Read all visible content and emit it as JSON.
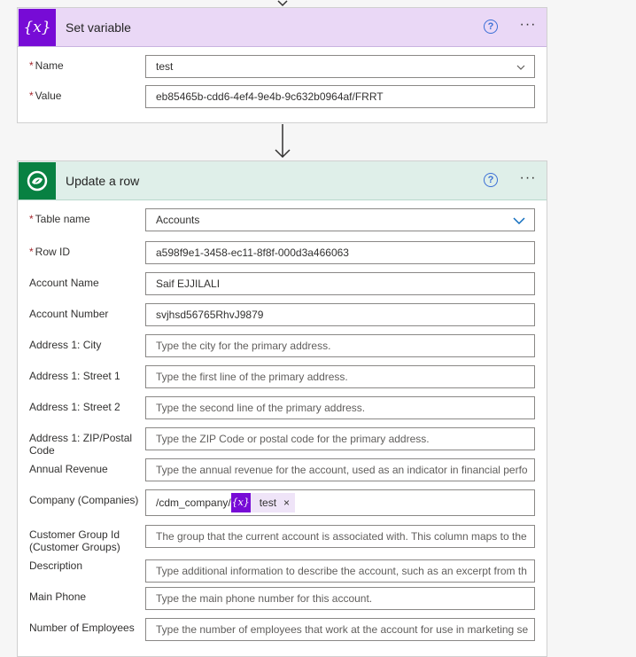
{
  "set_variable": {
    "title": "Set variable",
    "icon": "variable-icon",
    "icon_text": "{x}",
    "name_label": "Name",
    "name_value": "test",
    "value_label": "Value",
    "value_value": "eb85465b-cdd6-4ef4-9e4b-9c632b0964af/FRRT"
  },
  "update_row": {
    "title": "Update a row",
    "icon": "dataverse-icon",
    "fields": [
      {
        "label": "Table name",
        "required": true,
        "value": "Accounts",
        "placeholder": false
      },
      {
        "label": "Row ID",
        "required": true,
        "value": "a598f9e1-3458-ec11-8f8f-000d3a466063",
        "placeholder": false
      },
      {
        "label": "Account Name",
        "required": false,
        "value": "Saif EJJILALI",
        "placeholder": false
      },
      {
        "label": "Account Number",
        "required": false,
        "value": "svjhsd56765RhvJ9879",
        "placeholder": false
      },
      {
        "label": "Address 1: City",
        "required": false,
        "value": "Type the city for the primary address.",
        "placeholder": true
      },
      {
        "label": "Address 1: Street 1",
        "required": false,
        "value": "Type the first line of the primary address.",
        "placeholder": true
      },
      {
        "label": "Address 1: Street 2",
        "required": false,
        "value": "Type the second line of the primary address.",
        "placeholder": true
      },
      {
        "label": "Address 1: ZIP/Postal Code",
        "required": false,
        "value": "Type the ZIP Code or postal code for the primary address.",
        "placeholder": true
      },
      {
        "label": "Annual Revenue",
        "required": false,
        "value": "Type the annual revenue for the account, used as an indicator in financial perfo",
        "placeholder": true
      },
      {
        "label": "Company (Companies)",
        "required": false,
        "value": "/cdm_company/",
        "placeholder": false
      },
      {
        "label": "Customer Group Id (Customer Groups)",
        "required": false,
        "value": "The group that the current account is associated with. This column maps to the",
        "placeholder": true
      },
      {
        "label": "Description",
        "required": false,
        "value": "Type additional information to describe the account, such as an excerpt from th",
        "placeholder": true
      },
      {
        "label": "Main Phone",
        "required": false,
        "value": "Type the main phone number for this account.",
        "placeholder": true
      },
      {
        "label": "Number of Employees",
        "required": false,
        "value": "Type the number of employees that work at the account for use in marketing se",
        "placeholder": true
      }
    ],
    "company_token": {
      "icon_text": "{x}",
      "label": "test",
      "close": "×"
    }
  },
  "common": {
    "help": "?",
    "more": "···",
    "required_mark": "*"
  },
  "colors": {
    "variable_purple": "#770bd6",
    "dataverse_green": "#088142",
    "link_blue": "#3b6fd6"
  }
}
